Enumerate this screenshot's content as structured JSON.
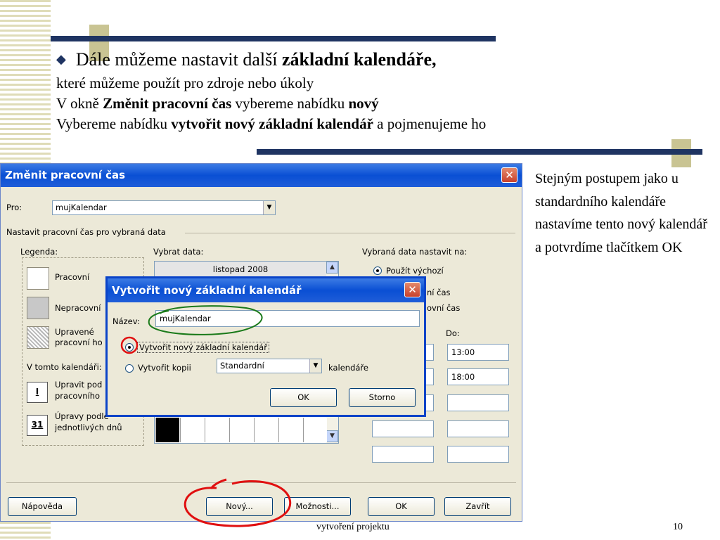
{
  "slide": {
    "line1_pre": "Dále můžeme nastavit další ",
    "line1_bold": "základní kalendáře,",
    "line2": "které můžeme použít pro zdroje nebo úkoly",
    "line3_pre": "V okně ",
    "line3_bold1": "Změnit pracovní čas",
    "line3_mid": " vybereme nabídku ",
    "line3_bold2": "nový",
    "line4_pre": "Vybereme nabídku ",
    "line4_bold": "vytvořit nový základní kalendář",
    "line4_post": " a pojmenujeme ho",
    "side_text": "Stejným postupem jako u standardního kalendáře nastavíme tento nový kalendář a potvrdíme tlačítkem OK",
    "footer": "vytvoření projektu",
    "page_number": "10"
  },
  "main_window": {
    "title": "Změnit pracovní čas",
    "close": "✕",
    "pro_label": "Pro:",
    "pro_value": "mujKalendar",
    "group_label": "Nastavit pracovní čas pro vybraná data",
    "legend_label": "Legenda:",
    "legend_items": [
      "Pracovní",
      "Nepracovní",
      "Upravené",
      "pracovní ho"
    ],
    "in_calendar_label": "V tomto kalendáři:",
    "in_calendar_items": [
      {
        "icon": "I",
        "line1": "Upravit pod",
        "line2": "pracovního"
      },
      {
        "icon": "31",
        "line1": "Úpravy podle",
        "line2": "jednotlivých dnů"
      }
    ],
    "select_data_label": "Vybrat data:",
    "month": "listopad 2008",
    "set_label": "Vybraná data nastavit na:",
    "radio_default": "Použít výchozí",
    "radio_nonwork": "ní čas",
    "radio_nondefault": "ovní čas",
    "do_label": "Do:",
    "times_to": [
      "13:00",
      "18:00",
      "",
      "",
      ""
    ],
    "buttons": {
      "help": "Nápověda",
      "new": "Nový...",
      "options": "Možnosti...",
      "ok": "OK",
      "close": "Zavřít"
    }
  },
  "dialog": {
    "title": "Vytvořit nový základní kalendář",
    "close": "✕",
    "name_label": "Název:",
    "name_value": "mujKalendar",
    "radio1": "Vytvořit nový základní kalendář",
    "radio2": "Vytvořit kopii",
    "copy_value": "Standardní",
    "copy_suffix": "kalendáře",
    "ok": "OK",
    "cancel": "Storno"
  },
  "colors": {
    "accent_bar": "#1f3462",
    "accent_block": "#c9c493",
    "annotation_green": "#1a7a1a",
    "annotation_red": "#e01010"
  }
}
